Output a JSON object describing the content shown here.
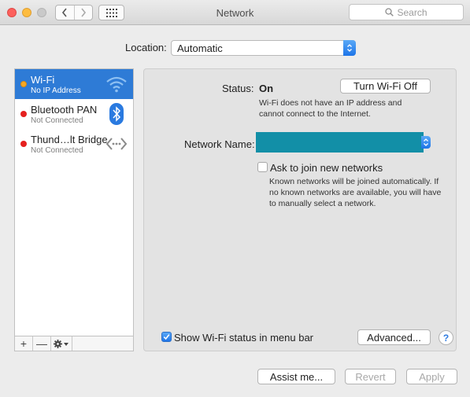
{
  "window": {
    "title": "Network"
  },
  "search": {
    "placeholder": "Search"
  },
  "location": {
    "label": "Location:",
    "value": "Automatic"
  },
  "services": [
    {
      "name": "Wi-Fi",
      "status": "No IP Address",
      "dot_color": "#f7a823",
      "icon": "wifi-icon",
      "selected": true
    },
    {
      "name": "Bluetooth PAN",
      "status": "Not Connected",
      "dot_color": "#e5201e",
      "icon": "bluetooth-icon",
      "selected": false
    },
    {
      "name": "Thund…lt Bridge",
      "status": "Not Connected",
      "dot_color": "#e5201e",
      "icon": "thunderbolt-bridge-icon",
      "selected": false
    }
  ],
  "toolbar": {
    "add": "+",
    "remove": "—"
  },
  "detail": {
    "status_label": "Status:",
    "status_value": "On",
    "turn_off_button": "Turn Wi-Fi Off",
    "status_desc_1": "Wi-Fi does not have an IP address and",
    "status_desc_2": "cannot connect to the Internet.",
    "network_name_label": "Network Name:",
    "network_name_color": "#128fa7",
    "ask_join_label": "Ask to join new networks",
    "ask_join_desc_1": "Known networks will be joined automatically. If",
    "ask_join_desc_2": "no known networks are available, you will have",
    "ask_join_desc_3": "to manually select a network.",
    "show_status_label": "Show Wi-Fi status in menu bar",
    "advanced_button": "Advanced...",
    "help": "?"
  },
  "footer": {
    "assist": "Assist me...",
    "revert": "Revert",
    "apply": "Apply"
  },
  "colors": {
    "accent": "#2e7bd6",
    "selection": "#2e7bd6"
  }
}
